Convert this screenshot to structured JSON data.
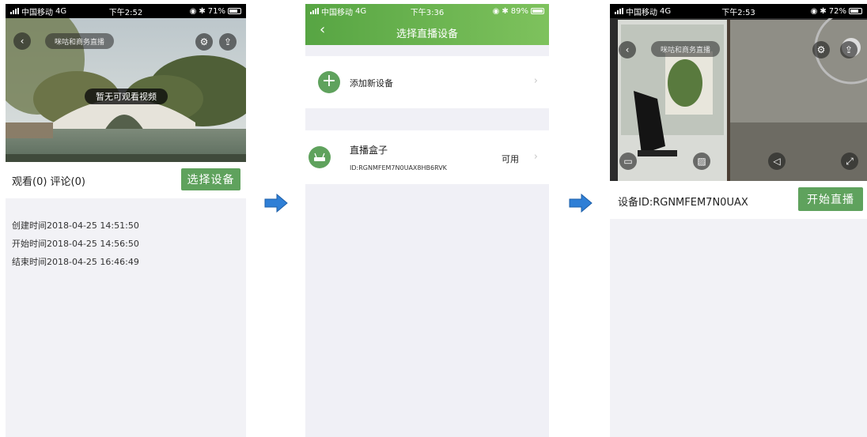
{
  "screen1": {
    "status": {
      "carrier": "中国移动",
      "network": "4G",
      "time": "下午2:52",
      "battery": "71%"
    },
    "stream_title": "咪咕和商务直播",
    "no_video": "暂无可观看视频",
    "stats": "观看(0) 评论(0)",
    "select_button": "选择设备",
    "created": "创建时间2018-04-25 14:51:50",
    "started": "开始时间2018-04-25 14:56:50",
    "ended": "结束时间2018-04-25 16:46:49"
  },
  "screen2": {
    "status": {
      "carrier": "中国移动",
      "network": "4G",
      "time": "下午3:36",
      "battery": "89%"
    },
    "title": "选择直播设备",
    "add_device": "添加新设备",
    "device_name": "直播盒子",
    "device_id": "ID:RGNMFEM7N0UAX8HB6RVK",
    "device_status": "可用"
  },
  "screen3": {
    "status": {
      "carrier": "中国移动",
      "network": "4G",
      "time": "下午2:53",
      "battery": "72%"
    },
    "stream_title": "咪咕和商务直播",
    "device_id": "设备ID:RGNMFEM7N0UAX",
    "start_button": "开始直播"
  },
  "colors": {
    "accent_green": "#5fa25d",
    "arrow_blue": "#2f7fd6"
  }
}
